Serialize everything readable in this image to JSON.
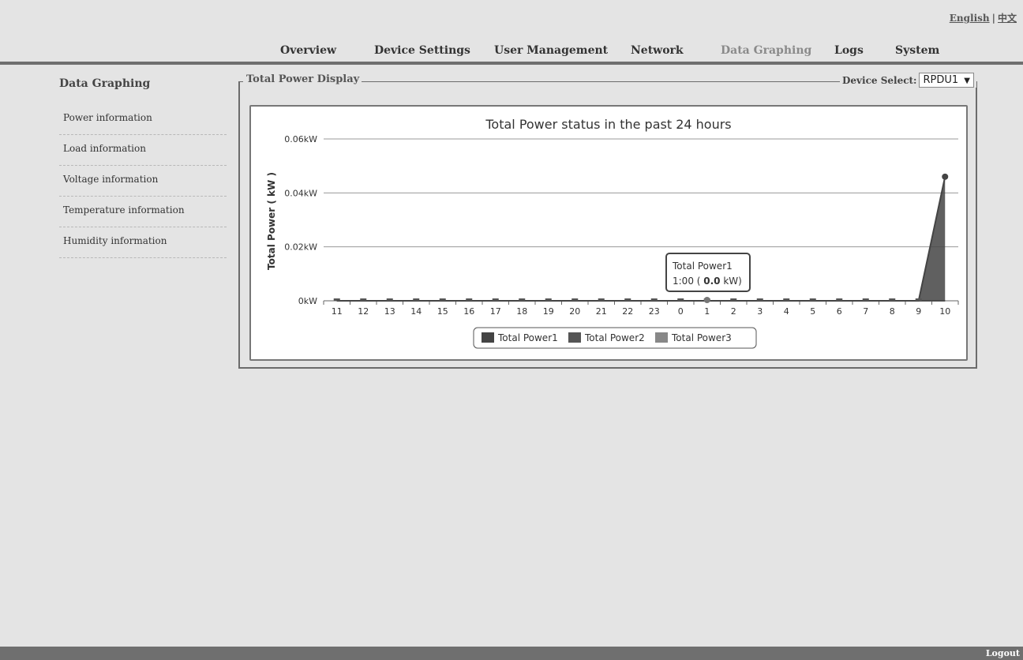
{
  "lang": {
    "english": "English",
    "chinese": "中文",
    "separator": "|"
  },
  "nav": {
    "items": [
      {
        "label": "Overview"
      },
      {
        "label": "Device Settings"
      },
      {
        "label": "User Management"
      },
      {
        "label": "Network"
      },
      {
        "label": "Data Graphing"
      },
      {
        "label": "Logs"
      },
      {
        "label": "System"
      }
    ],
    "active": "Data Graphing"
  },
  "sidebar": {
    "title": "Data Graphing",
    "items": [
      {
        "label": "Power information"
      },
      {
        "label": "Load information"
      },
      {
        "label": "Voltage information"
      },
      {
        "label": "Temperature information"
      },
      {
        "label": "Humidity information"
      }
    ]
  },
  "panel": {
    "title": "Total Power Display",
    "device_select_label": "Device Select:",
    "device_select_value": "RPDU1",
    "select_arrow": "▼"
  },
  "tooltip": {
    "series": "Total Power1",
    "time": "1:00",
    "value": "0.0",
    "unit": "kW"
  },
  "chart_data": {
    "type": "area",
    "title": "Total Power status in the past 24 hours",
    "ylabel": "Total Power ( kW )",
    "xlabel": "",
    "ylim": [
      0,
      0.06
    ],
    "yticks": [
      "0kW",
      "0.02kW",
      "0.04kW",
      "0.06kW"
    ],
    "categories": [
      "11",
      "12",
      "13",
      "14",
      "15",
      "16",
      "17",
      "18",
      "19",
      "20",
      "21",
      "22",
      "23",
      "0",
      "1",
      "2",
      "3",
      "4",
      "5",
      "6",
      "7",
      "8",
      "9",
      "10"
    ],
    "series": [
      {
        "name": "Total Power1",
        "color": "#444444",
        "values": [
          0,
          0,
          0,
          0,
          0,
          0,
          0,
          0,
          0,
          0,
          0,
          0,
          0,
          0,
          0,
          0,
          0,
          0,
          0,
          0,
          0,
          0,
          0,
          0.046
        ]
      },
      {
        "name": "Total Power2",
        "color": "#555555",
        "values": [
          0,
          0,
          0,
          0,
          0,
          0,
          0,
          0,
          0,
          0,
          0,
          0,
          0,
          0,
          0,
          0,
          0,
          0,
          0,
          0,
          0,
          0,
          0,
          0
        ]
      },
      {
        "name": "Total Power3",
        "color": "#888888",
        "values": [
          0,
          0,
          0,
          0,
          0,
          0,
          0,
          0,
          0,
          0,
          0,
          0,
          0,
          0,
          0,
          0,
          0,
          0,
          0,
          0,
          0,
          0,
          0,
          0
        ]
      }
    ],
    "legend_position": "bottom",
    "grid": true
  },
  "footer": {
    "logout": "Logout"
  }
}
